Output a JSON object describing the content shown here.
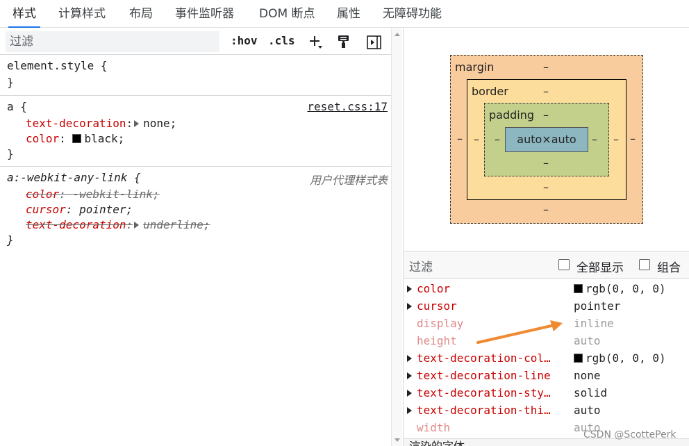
{
  "tabs": [
    "样式",
    "计算样式",
    "布局",
    "事件监听器",
    "DOM 断点",
    "属性",
    "无障碍功能"
  ],
  "styles_toolbar": {
    "filter_placeholder": "过滤",
    "hov": ":hov",
    "cls": ".cls"
  },
  "rules": {
    "element_style": {
      "selector": "element.style {",
      "close": "}"
    },
    "a_rule": {
      "selector": "a {",
      "source": "reset.css:17",
      "decl1_prop": "text-decoration",
      "decl1_val": "none;",
      "decl2_prop": "color",
      "decl2_val": "black;",
      "close": "}"
    },
    "ua_rule": {
      "selector": "a:-webkit-any-link {",
      "source": "用户代理样式表",
      "decl1_prop": "color",
      "decl1_val": "-webkit-link;",
      "decl2_prop": "cursor",
      "decl2_val": "pointer;",
      "decl3_prop": "text-decoration",
      "decl3_val": "underline;",
      "close": "}"
    }
  },
  "box_model": {
    "margin_label": "margin",
    "border_label": "border",
    "padding_label": "padding",
    "content": "auto×auto",
    "dash": "–"
  },
  "computed_toolbar": {
    "filter_placeholder": "过滤",
    "show_all": "全部显示",
    "group": "组合"
  },
  "computed": [
    {
      "name": "color",
      "value": "rgb(0, 0, 0)"
    },
    {
      "name": "cursor",
      "value": "pointer"
    },
    {
      "name": "display",
      "value": "inline"
    },
    {
      "name": "height",
      "value": "auto"
    },
    {
      "name": "text-decoration-col…",
      "value": "rgb(0, 0, 0)"
    },
    {
      "name": "text-decoration-line",
      "value": "none"
    },
    {
      "name": "text-decoration-sty…",
      "value": "solid"
    },
    {
      "name": "text-decoration-thi…",
      "value": "auto"
    },
    {
      "name": "width",
      "value": "auto"
    }
  ],
  "rendered_fonts_label": "渲染的字体",
  "watermark": "CSDN @ScottePerk",
  "colors": {
    "accent": "#1a73e8",
    "property": "#c80000",
    "arrow": "#f08a30"
  }
}
